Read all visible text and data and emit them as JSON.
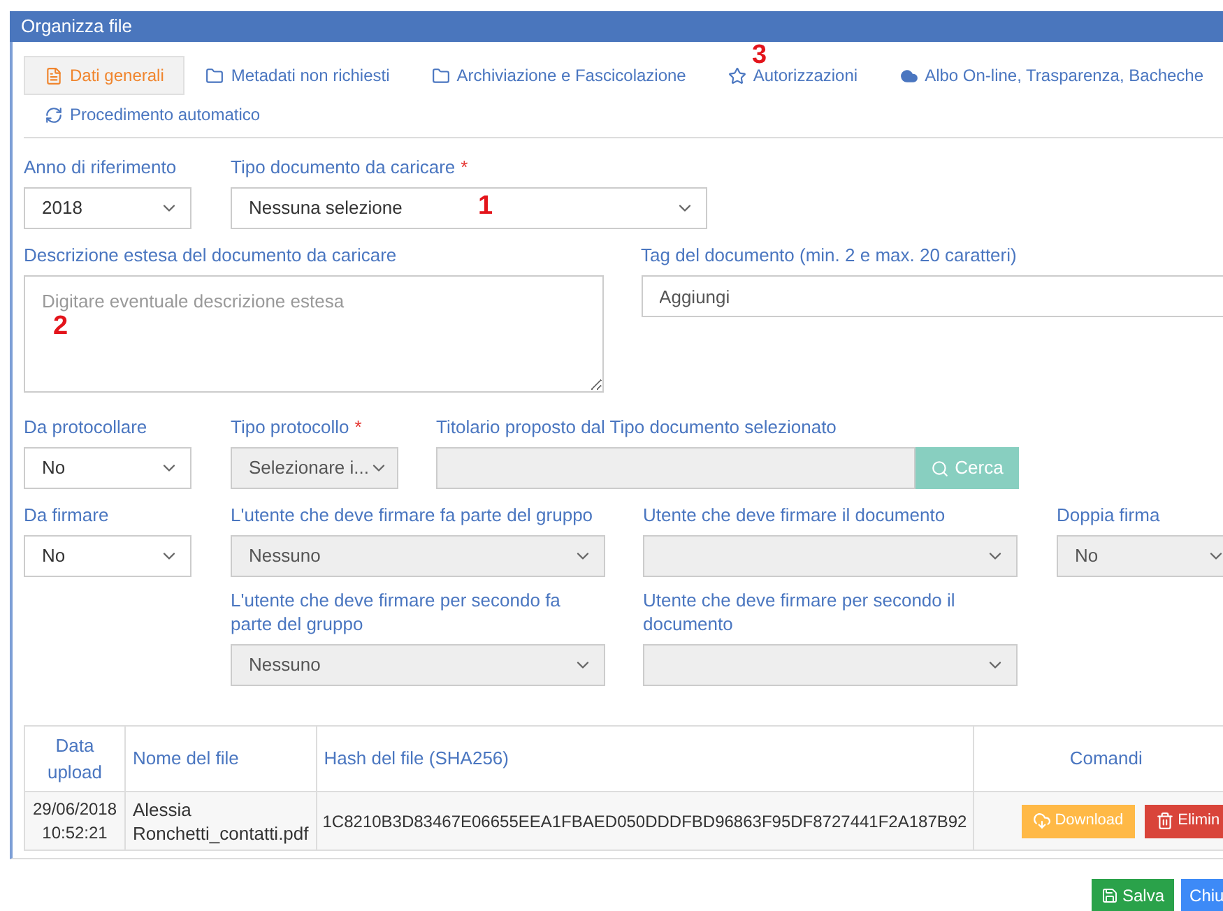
{
  "window": {
    "title": "Organizza file"
  },
  "tabs": [
    {
      "label": "Dati generali",
      "kind": "file",
      "selected": true
    },
    {
      "label": "Metadati non richiesti",
      "kind": "folder",
      "selected": false
    },
    {
      "label": "Archiviazione e Fascicolazione",
      "kind": "folder",
      "selected": false
    },
    {
      "label": "Autorizzazioni",
      "kind": "star",
      "selected": false
    },
    {
      "label": "Albo On-line, Trasparenza, Bacheche",
      "kind": "cloud",
      "selected": false
    },
    {
      "label": "Procedimento automatico",
      "kind": "refresh",
      "selected": false
    }
  ],
  "anno": {
    "label": "Anno di riferimento",
    "value": "2018",
    "disabled": false
  },
  "tipo_documento": {
    "label": "Tipo documento da caricare",
    "required_mark": "*",
    "value": "Nessuna selezione",
    "disabled": false
  },
  "descrizione": {
    "label": "Descrizione estesa del documento da caricare",
    "placeholder": "Digitare eventuale descrizione estesa"
  },
  "tag": {
    "label": "Tag del documento (min. 2 e max. 20 caratteri)",
    "placeholder": "Aggiungi"
  },
  "da_protocollare": {
    "label": "Da protocollare",
    "value": "No",
    "disabled": false
  },
  "tipo_protocollo": {
    "label": "Tipo protocollo",
    "required_mark": "*",
    "value": "Selezionare i...",
    "disabled": true
  },
  "titolario": {
    "label": "Titolario proposto dal Tipo documento selezionato",
    "button": "Cerca"
  },
  "da_firmare": {
    "label": "Da firmare",
    "value": "No",
    "disabled": false
  },
  "gruppo_firma": {
    "label": "L'utente che deve firmare fa parte del gruppo",
    "value": "Nessuno",
    "disabled": true
  },
  "utente_firma": {
    "label": "Utente che deve firmare il documento",
    "disabled": true
  },
  "doppia_firma": {
    "label": "Doppia firma",
    "value": "No",
    "disabled": true
  },
  "gruppo_secondo": {
    "label": "L'utente che deve firmare per secondo fa parte del gruppo",
    "value": "Nessuno",
    "disabled": true
  },
  "utente_secondo": {
    "label": "Utente che deve firmare per secondo il documento",
    "disabled": true
  },
  "table": {
    "columns": [
      "Data upload",
      "Nome del file",
      "Hash del file (SHA256)",
      "Comandi"
    ],
    "rows": [
      {
        "date": "29/06/2018 10:52:21",
        "name": "Alessia Ronchetti_contatti.pdf",
        "hash": "1C8210B3D83467E06655EEA1FBAED050DDDFBD96863F95DF8727441F2A187B92",
        "download": "Download",
        "delete": "Elimin"
      }
    ]
  },
  "footer": {
    "save": "Salva",
    "close": "Chiu"
  },
  "annotations": [
    "3",
    "1",
    "2"
  ]
}
